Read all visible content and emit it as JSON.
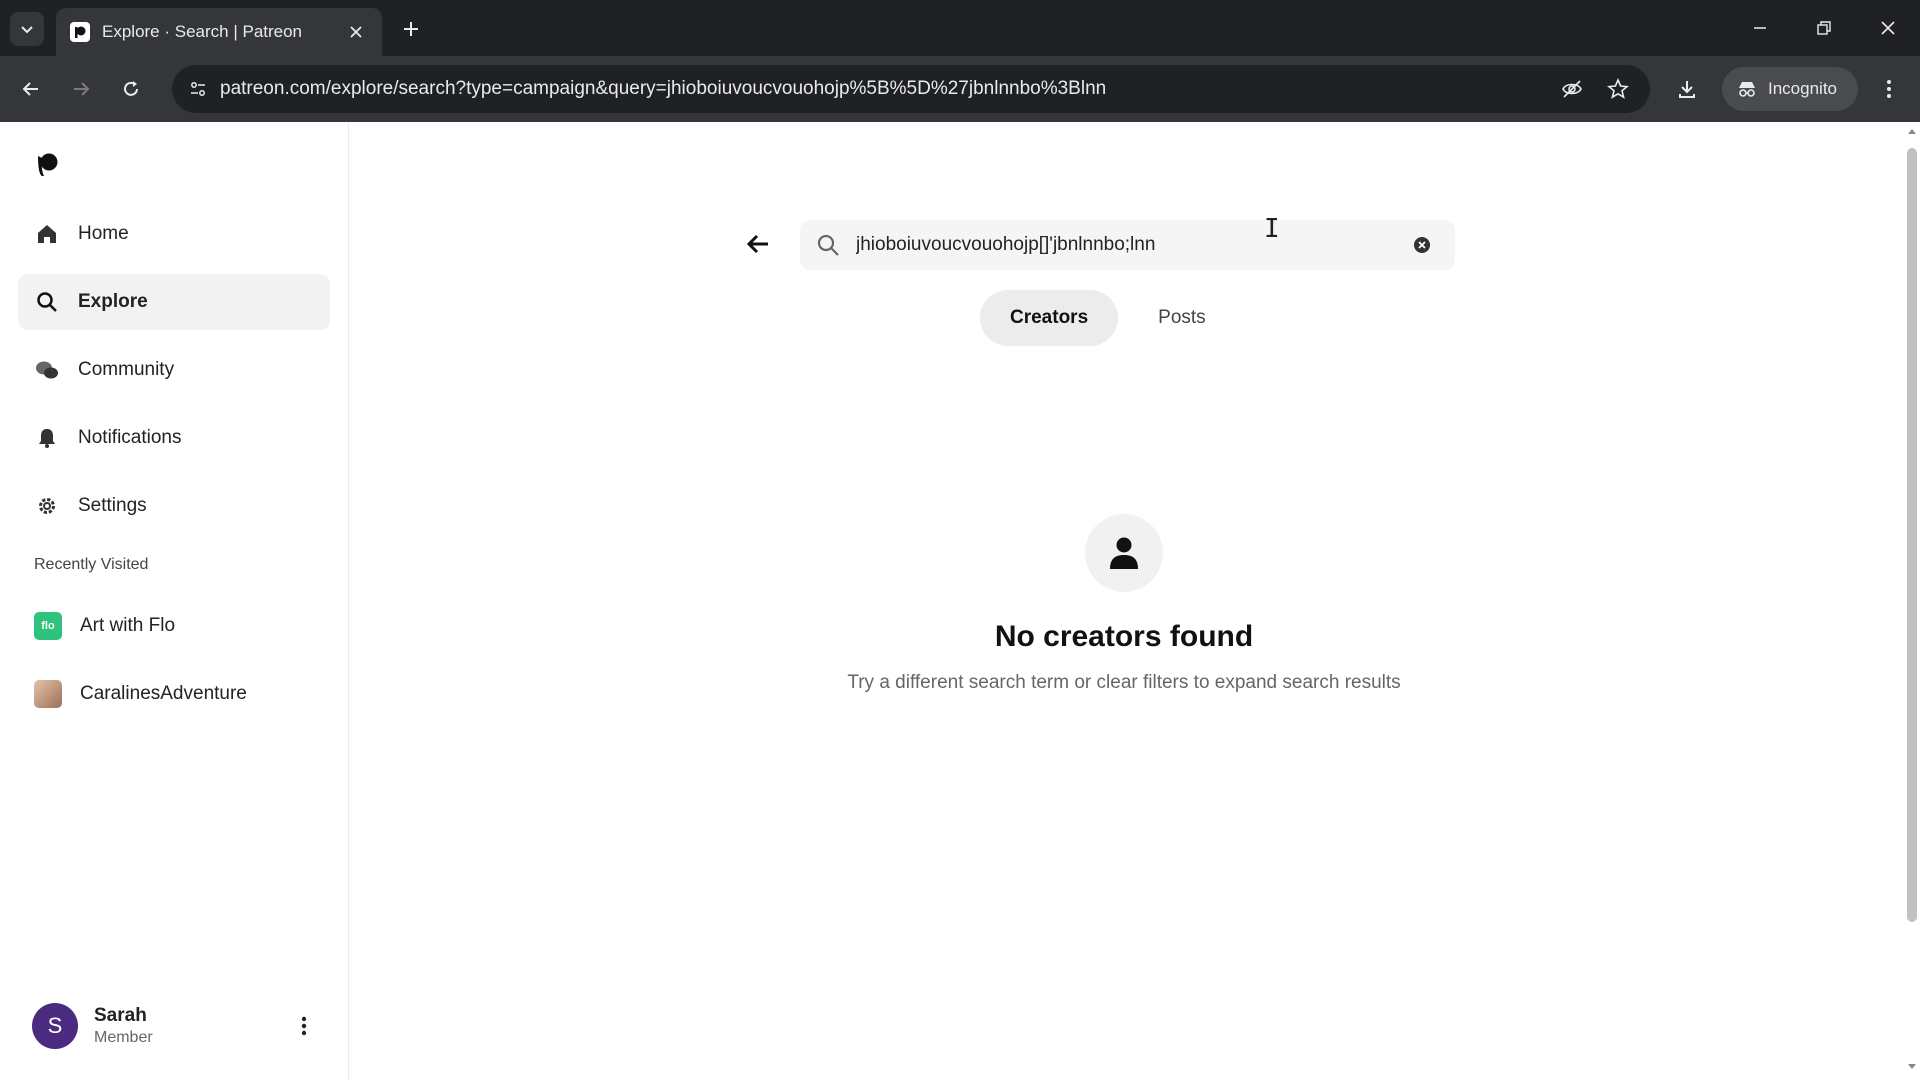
{
  "browser": {
    "tab_title": "Explore · Search | Patreon",
    "url": "patreon.com/explore/search?type=campaign&query=jhioboiuvoucvouohojp%5B%5D%27jbnlnnbo%3Blnn",
    "incognito_label": "Incognito"
  },
  "sidebar": {
    "nav": [
      {
        "label": "Home",
        "icon": "home-icon"
      },
      {
        "label": "Explore",
        "icon": "search-icon",
        "active": true
      },
      {
        "label": "Community",
        "icon": "chat-bubbles-icon"
      },
      {
        "label": "Notifications",
        "icon": "bell-icon"
      },
      {
        "label": "Settings",
        "icon": "gear-icon"
      }
    ],
    "recent_heading": "Recently Visited",
    "recent": [
      {
        "label": "Art with Flo",
        "badge": "flo",
        "color": "#2fc27a"
      },
      {
        "label": "CaralinesAdventure",
        "color": "#c9a48a"
      }
    ],
    "profile": {
      "initial": "S",
      "name": "Sarah",
      "role": "Member"
    }
  },
  "search": {
    "value": "jhioboiuvoucvouohojp[]'jbnlnnbo;lnn"
  },
  "tabs": {
    "creators": "Creators",
    "posts": "Posts"
  },
  "empty_state": {
    "title": "No creators found",
    "description": "Try a different search term or clear filters to expand search results"
  },
  "colors": {
    "avatar": "#4b2b7f",
    "active_tab_bg": "#ececec"
  }
}
